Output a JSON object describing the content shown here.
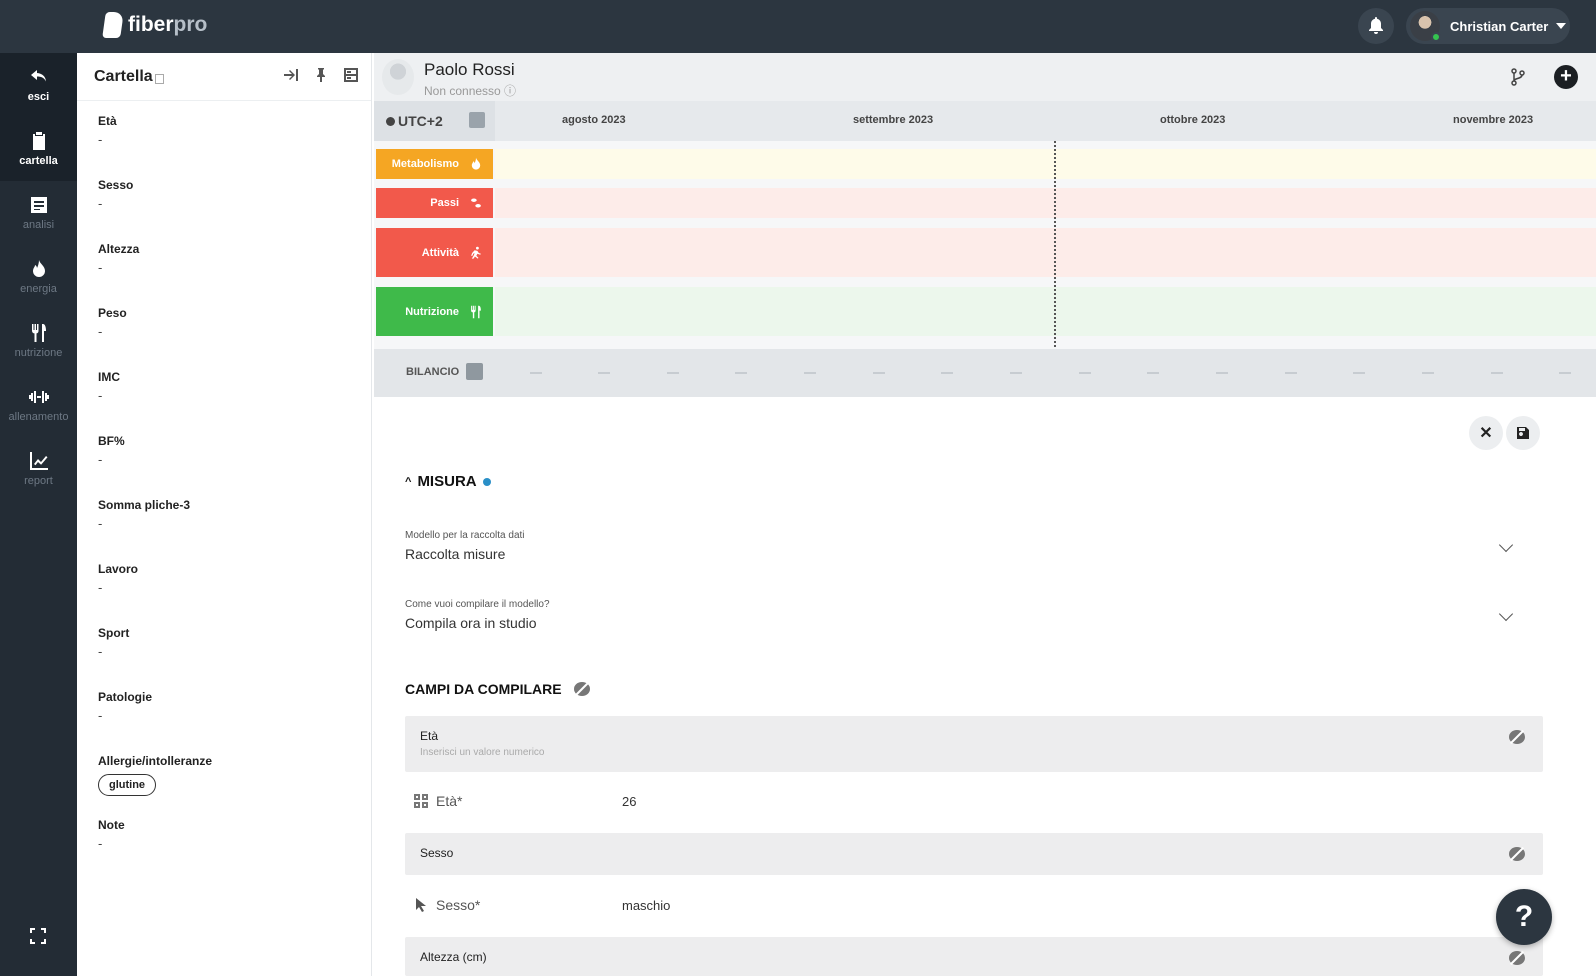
{
  "brand": {
    "name": "fiber",
    "suffix": "pro"
  },
  "user": {
    "name": "Christian Carter"
  },
  "nav": {
    "exit_label": "esci",
    "items": [
      {
        "label": "cartella",
        "icon": "clipboard-icon"
      },
      {
        "label": "analisi",
        "icon": "document-icon"
      },
      {
        "label": "energia",
        "icon": "flame-icon"
      },
      {
        "label": "nutrizione",
        "icon": "fork-knife-icon"
      },
      {
        "label": "allenamento",
        "icon": "dumbbell-icon"
      },
      {
        "label": "report",
        "icon": "chart-line-icon"
      }
    ]
  },
  "cartella": {
    "title": "Cartella",
    "fields": [
      {
        "label": "Età",
        "value": "-"
      },
      {
        "label": "Sesso",
        "value": "-"
      },
      {
        "label": "Altezza",
        "value": "-"
      },
      {
        "label": "Peso",
        "value": "-"
      },
      {
        "label": "IMC",
        "value": "-"
      },
      {
        "label": "BF%",
        "value": "-"
      },
      {
        "label": "Somma pliche-3",
        "value": "-"
      },
      {
        "label": "Lavoro",
        "value": "-"
      },
      {
        "label": "Sport",
        "value": "-"
      },
      {
        "label": "Patologie",
        "value": "-"
      },
      {
        "label": "Allergie/intolleranze",
        "tag": "glutine"
      },
      {
        "label": "Note",
        "value": "-"
      }
    ]
  },
  "patient": {
    "name": "Paolo Rossi",
    "status": "Non connesso ⓘ"
  },
  "timeline": {
    "timezone": "UTC+2",
    "months": [
      "agosto 2023",
      "settembre 2023",
      "ottobre 2023",
      "novembre 2023"
    ],
    "rows": [
      {
        "label": "Metabolismo",
        "color": "#f5a623",
        "band": "#fefbe9"
      },
      {
        "label": "Passi",
        "color": "#f2594b",
        "band": "#fdece9"
      },
      {
        "label": "Attività",
        "color": "#f2594b",
        "band": "#fdece9"
      },
      {
        "label": "Nutrizione",
        "color": "#3fba4a",
        "band": "#ecf7ec"
      }
    ],
    "bilancio_label": "BILANCIO"
  },
  "form": {
    "section_title": "MISURA",
    "model_label": "Modello per la raccolta dati",
    "model_value": "Raccolta misure",
    "mode_label": "Come vuoi compilare il modello?",
    "mode_value": "Compila ora in studio",
    "campi_title": "CAMPI DA COMPILARE",
    "cards": [
      {
        "title": "Età",
        "subtitle": "Inserisci un valore numerico",
        "value_label": "Età*",
        "value": "26"
      },
      {
        "title": "Sesso",
        "subtitle": "",
        "value_label": "Sesso*",
        "value": "maschio"
      },
      {
        "title": "Altezza (cm)"
      }
    ]
  },
  "help": {
    "label": "?"
  }
}
